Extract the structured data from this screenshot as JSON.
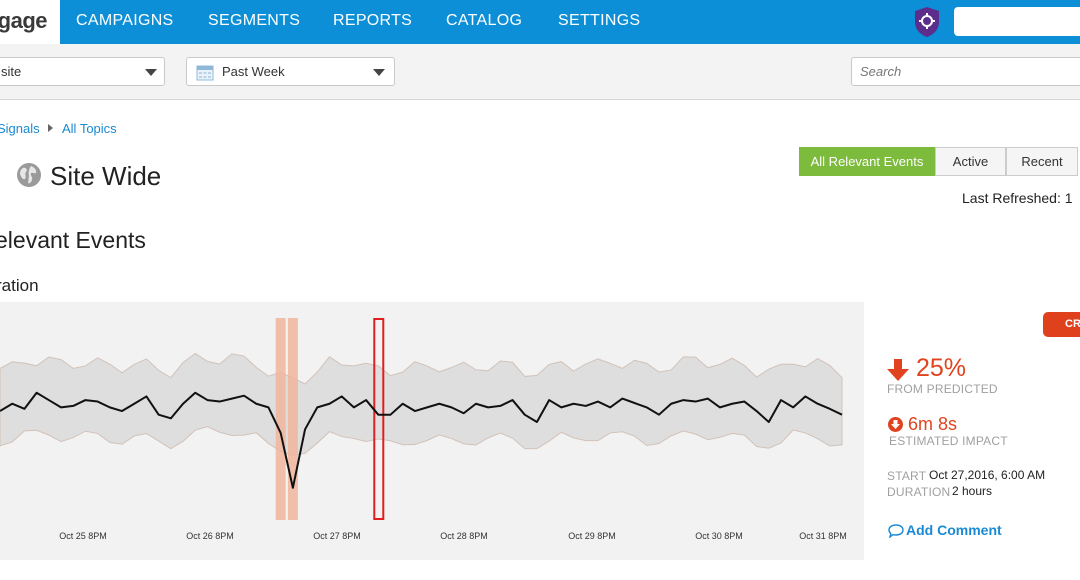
{
  "header": {
    "logo_text": "gage",
    "nav": [
      "CAMPAIGNS",
      "SEGMENTS",
      "REPORTS",
      "CATALOG",
      "SETTINGS"
    ],
    "search_value": ""
  },
  "filters": {
    "scope_value": "site",
    "range_value": "Past Week",
    "search_placeholder": "Search"
  },
  "breadcrumb": [
    "Signals",
    "All Topics"
  ],
  "page_title": "Site Wide",
  "tabs": [
    "All Relevant Events",
    "Active",
    "Recent"
  ],
  "active_tab": "All Relevant Events",
  "last_refreshed": "Last Refreshed: 1",
  "section_title": "elevant Events",
  "metric_title": "ration",
  "event": {
    "badge": "CR",
    "change_pct": "25%",
    "change_label": "FROM PREDICTED",
    "impact": "6m 8s",
    "impact_label": "ESTIMATED IMPACT",
    "start_label": "START",
    "start_value": "Oct 27,2016, 6:00 AM",
    "duration_label": "DURATION",
    "duration_value": "2 hours",
    "add_comment": "Add Comment"
  },
  "colors": {
    "nav_bg": "#0d8fd8",
    "accent_green": "#7cbb3c",
    "alert_red": "#e0441e",
    "link_blue": "#1a8ad4"
  },
  "chart_data": {
    "type": "line",
    "x_ticks": [
      "Oct 25 8PM",
      "Oct 26 8PM",
      "Oct 27 8PM",
      "Oct 28 8PM",
      "Oct 29 8PM",
      "Oct 30 8PM",
      "Oct 31 8PM"
    ],
    "series": [
      {
        "values": [
          0.45,
          0.55,
          0.48,
          0.7,
          0.6,
          0.5,
          0.52,
          0.6,
          0.58,
          0.5,
          0.45,
          0.55,
          0.65,
          0.4,
          0.35,
          0.55,
          0.7,
          0.6,
          0.58,
          0.62,
          0.66,
          0.55,
          0.5,
          0.15,
          -0.6,
          0.2,
          0.5,
          0.55,
          0.65,
          0.5,
          0.6,
          0.4,
          0.4,
          0.55,
          0.45,
          0.5,
          0.55,
          0.5,
          0.42,
          0.55,
          0.5,
          0.52,
          0.6,
          0.4,
          0.3,
          0.6,
          0.5,
          0.55,
          0.52,
          0.58,
          0.5,
          0.62,
          0.56,
          0.5,
          0.4,
          0.55,
          0.6,
          0.58,
          0.62,
          0.5,
          0.55,
          0.58,
          0.45,
          0.3,
          0.6,
          0.5,
          0.65,
          0.55,
          0.48,
          0.4
        ]
      }
    ],
    "band": {
      "description_free": true
    },
    "ylim": [
      -1,
      1.6
    ],
    "annotations": [
      {
        "type": "highlight",
        "x_index": 23,
        "style": "shaded"
      },
      {
        "type": "highlight",
        "x_index": 24,
        "style": "shaded"
      },
      {
        "type": "highlight",
        "x_index": 31,
        "style": "outlined"
      }
    ],
    "grid": false,
    "legend": "none"
  }
}
